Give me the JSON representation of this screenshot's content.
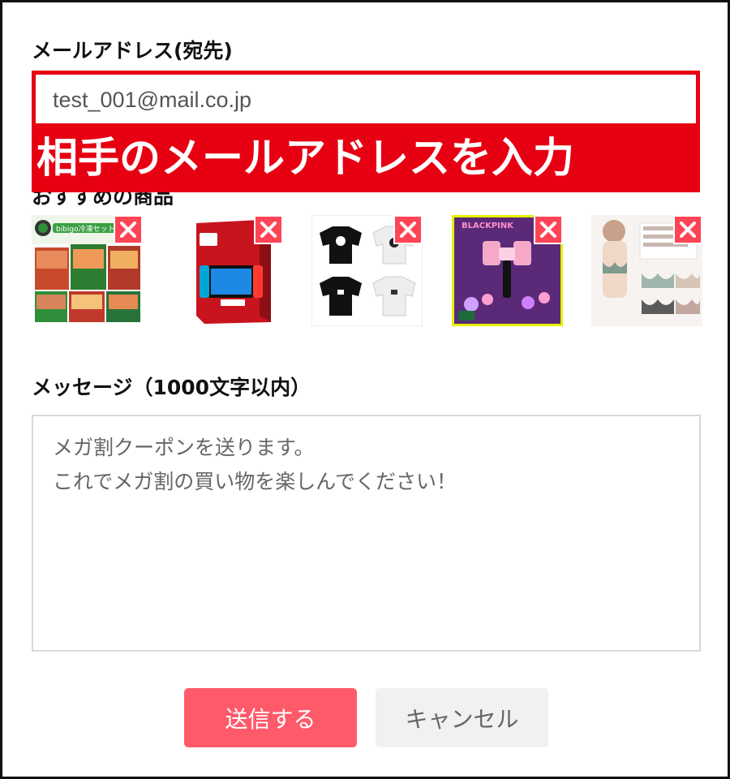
{
  "email": {
    "label": "メールアドレス(宛先)",
    "value": "test_001@mail.co.jp"
  },
  "callout": {
    "text": "相手のメールアドレスを入力",
    "color": "#e60012"
  },
  "recommended": {
    "label": "おすすめの商品",
    "items": [
      {
        "name": "bibigo-korean-food-set",
        "icon": "food-package-image",
        "printed_text": "bibigo冷凍セット"
      },
      {
        "name": "nintendo-switch-oled",
        "icon": "game-console-box-image"
      },
      {
        "name": "sweatshirt-set",
        "icon": "sweatshirt-image"
      },
      {
        "name": "blackpink-light-stick",
        "icon": "light-stick-image",
        "printed_text": "BLACKPINK"
      },
      {
        "name": "bra-set",
        "icon": "lingerie-image"
      }
    ],
    "remove_icon": "close-icon"
  },
  "message": {
    "label": "メッセージ（1000文字以内）",
    "value": "メガ割クーポンを送ります。\nこれでメガ割の買い物を楽しんでください！"
  },
  "buttons": {
    "send_label": "送信する",
    "cancel_label": "キャンセル"
  },
  "colors": {
    "accent_red": "#e60012",
    "send_button": "#ff5a6a",
    "remove_badge": "#ff4455",
    "cancel_button": "#f1f1f1"
  }
}
